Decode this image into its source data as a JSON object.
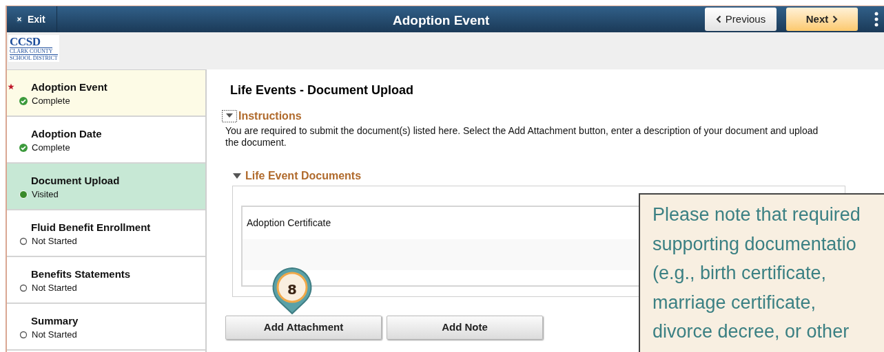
{
  "header": {
    "exit": "Exit",
    "title": "Adoption Event",
    "previous": "Previous",
    "next": "Next"
  },
  "logo": {
    "initials": "CCSD",
    "line1": "CLARK COUNTY",
    "line2": "SCHOOL DISTRICT"
  },
  "steps": [
    {
      "title": "Adoption Event",
      "status": "Complete",
      "kind": "complete",
      "required": true,
      "highlighted": true,
      "selected": false
    },
    {
      "title": "Adoption Date",
      "status": "Complete",
      "kind": "complete",
      "required": false,
      "highlighted": false,
      "selected": false
    },
    {
      "title": "Document Upload",
      "status": "Visited",
      "kind": "visited",
      "required": false,
      "highlighted": false,
      "selected": true
    },
    {
      "title": "Fluid Benefit Enrollment",
      "status": "Not Started",
      "kind": "not_started",
      "required": false,
      "highlighted": false,
      "selected": false
    },
    {
      "title": "Benefits Statements",
      "status": "Not Started",
      "kind": "not_started",
      "required": false,
      "highlighted": false,
      "selected": false
    },
    {
      "title": "Summary",
      "status": "Not Started",
      "kind": "not_started",
      "required": false,
      "highlighted": false,
      "selected": false
    }
  ],
  "page_title": "Life Events - Document Upload",
  "instructions": {
    "label": "Instructions",
    "expanded": true,
    "text": "You are required to submit the document(s) listed here. Select the Add Attachment button, enter a description of your document and upload the document."
  },
  "documents": {
    "label": "Life Event Documents",
    "expanded": true,
    "rows": [
      "Adoption Certificate"
    ]
  },
  "buttons": [
    "Add Attachment",
    "Add Note"
  ],
  "marker": "8",
  "callout": [
    "Please note that required",
    "supporting documentatio",
    "(e.g., birth certificate,",
    "marriage certificate,",
    "divorce decree, or other"
  ]
}
